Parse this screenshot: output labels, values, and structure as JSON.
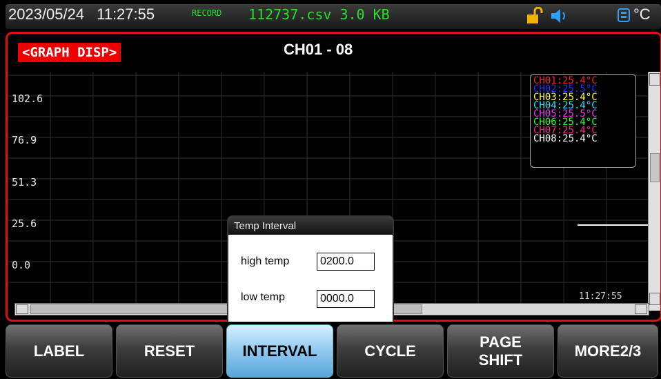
{
  "status": {
    "date": "2023/05/24",
    "time": "11:27:55",
    "record_label": "RECORD",
    "record_file": "112737.csv",
    "record_size": "3.0 KB",
    "unit": "°C"
  },
  "graph": {
    "title_tag": "<GRAPH DISP>",
    "channel_range": "CH01 - 08",
    "y_ticks": [
      "102.6",
      "76.9",
      "51.3",
      "25.6",
      "0.0"
    ],
    "time_label": "11:27:55",
    "legend": [
      {
        "label": "CH01:25.4°C",
        "color": "#ff2020"
      },
      {
        "label": "CH02:25.5°C",
        "color": "#2030ff"
      },
      {
        "label": "CH03:25.4°C",
        "color": "#ffff20"
      },
      {
        "label": "CH04:25.4°C",
        "color": "#20e8ff"
      },
      {
        "label": "CH05:25.5°C",
        "color": "#ff30ff"
      },
      {
        "label": "CH06:25.4°C",
        "color": "#20ff20"
      },
      {
        "label": "CH07:25.4°C",
        "color": "#ff2090"
      },
      {
        "label": "CH08:25.4°C",
        "color": "#ffffff"
      }
    ]
  },
  "dialog": {
    "title": "Temp Interval",
    "high_label": "high temp",
    "high_value": "0200.0",
    "low_label": "low temp",
    "low_value": "0000.0"
  },
  "buttons": {
    "label": "LABEL",
    "reset": "RESET",
    "interval": "INTERVAL",
    "cycle": "CYCLE",
    "page_shift_1": "PAGE",
    "page_shift_2": "SHIFT",
    "more": "MORE2/3"
  },
  "colors": {
    "accent_red": "#e01010",
    "record_green": "#28e028",
    "active_button": "#8ec8ef"
  }
}
